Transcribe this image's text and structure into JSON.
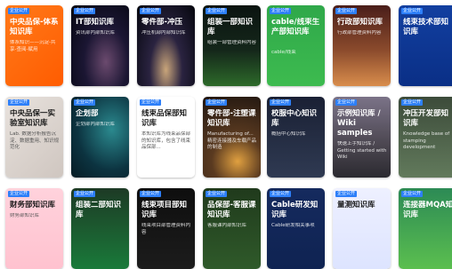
{
  "badge_label": "企业公开",
  "cards": [
    {
      "title": "中央品保-体系知识库",
      "desc": "体系知识——沉淀-共享-查阅-赋用",
      "bg": "orange"
    },
    {
      "title": "IT部知识库",
      "desc": "资讯部内部知识库",
      "bg": "galaxy"
    },
    {
      "title": "零件部-冲压",
      "desc": "冲压机部内部知识库",
      "bg": "milkyway"
    },
    {
      "title": "组装一部知识库",
      "desc": "组装一部管理资料内容",
      "bg": "golf"
    },
    {
      "title": "cable/线束生产部知识库",
      "desc": "cable/线束",
      "bg": "green"
    },
    {
      "title": "行政部知识库",
      "desc": "行政部管理资料内容",
      "bg": "dusk"
    },
    {
      "title": "线束技术部知识库",
      "desc": "",
      "bg": "navy"
    },
    {
      "title": "中央品保一实验室知识库",
      "desc": "Lab. 数据分析报告沉淀、数据重用、知识规范化",
      "bg": "lab"
    },
    {
      "title": "企划部",
      "desc": "企划部内部知识库",
      "bg": "teal"
    },
    {
      "title": "线束品保部知识库",
      "desc": "本知识库为线束品保部的知识库，包含了线束品保部...",
      "bg": "white"
    },
    {
      "title": "零件部-注塑课知识库",
      "desc": "Manufacturing of... 精密连接器及车载产品的制造",
      "bg": "gears"
    },
    {
      "title": "校服中心知识库",
      "desc": "概括中心知识库",
      "bg": "night"
    },
    {
      "title": "示例知识库 / Wiki samples",
      "desc": "快速上手知识库 / Getting started with Wiki",
      "bg": "stone"
    },
    {
      "title": "冲压开发部知识库",
      "desc": "Knowledge base of stamping development",
      "bg": "office"
    },
    {
      "title": "财务部知识库",
      "desc": "财务部知识库",
      "bg": "pink"
    },
    {
      "title": "组装二部知识库",
      "desc": "",
      "bg": "forest"
    },
    {
      "title": "线束项目部知识库",
      "desc": "线束项目部管理资料内容",
      "bg": "black"
    },
    {
      "title": "品保部-客服课知识库",
      "desc": "客服课内部知识库",
      "bg": "jungle"
    },
    {
      "title": "Cable研发知识库",
      "desc": "Cable研发相关事项",
      "bg": "spacenavy"
    },
    {
      "title": "量测知识库",
      "desc": "",
      "bg": "ball"
    },
    {
      "title": "连接器MQA知识库",
      "desc": "",
      "bg": "meadow"
    }
  ]
}
